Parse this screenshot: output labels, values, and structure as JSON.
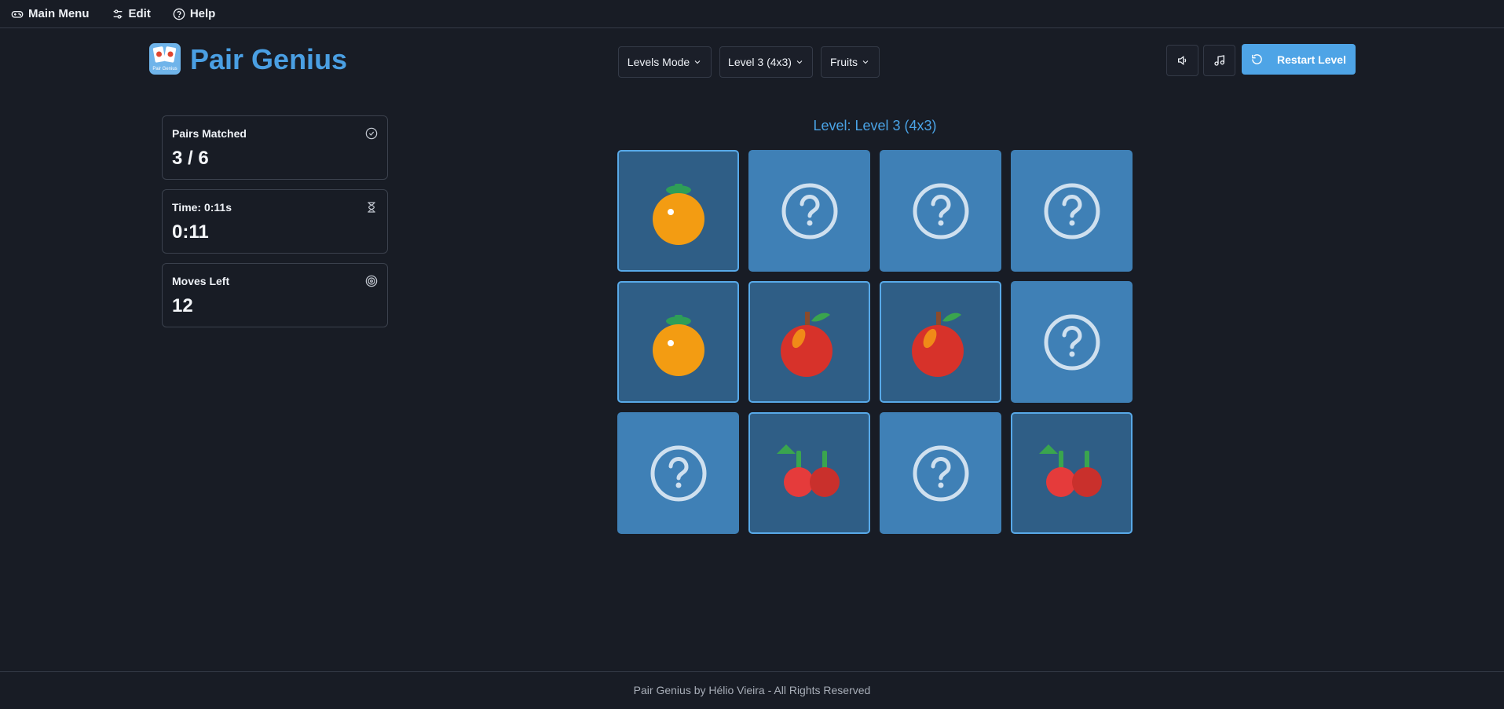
{
  "menubar": {
    "items": [
      {
        "label": "Main Menu",
        "icon": "gamepad-icon"
      },
      {
        "label": "Edit",
        "icon": "sliders-icon"
      },
      {
        "label": "Help",
        "icon": "help-circle-icon"
      }
    ]
  },
  "header": {
    "app_title": "Pair Genius",
    "logo_caption": "Pair Genius",
    "mode_select": "Levels Mode",
    "level_select": "Level 3 (4x3)",
    "theme_select": "Fruits",
    "restart_label": "Restart Level",
    "accent_color": "#4ea4e6"
  },
  "stats": {
    "pairs": {
      "label": "Pairs Matched",
      "value": "3 / 6",
      "icon": "check-circle-icon"
    },
    "time": {
      "label": "Time: 0:11s",
      "value": "0:11",
      "icon": "hourglass-icon"
    },
    "moves": {
      "label": "Moves Left",
      "value": "12",
      "icon": "target-icon"
    }
  },
  "board": {
    "heading": "Level: Level 3 (4x3)",
    "columns": 4,
    "rows": 3,
    "cards": [
      {
        "state": "revealed",
        "fruit": "orange"
      },
      {
        "state": "hidden",
        "fruit": "question-mark"
      },
      {
        "state": "hidden",
        "fruit": "question-mark"
      },
      {
        "state": "hidden",
        "fruit": "question-mark"
      },
      {
        "state": "revealed",
        "fruit": "orange"
      },
      {
        "state": "revealed",
        "fruit": "apple"
      },
      {
        "state": "revealed",
        "fruit": "apple"
      },
      {
        "state": "hidden",
        "fruit": "question-mark"
      },
      {
        "state": "hidden",
        "fruit": "question-mark"
      },
      {
        "state": "revealed",
        "fruit": "cherries"
      },
      {
        "state": "hidden",
        "fruit": "question-mark"
      },
      {
        "state": "revealed",
        "fruit": "cherries"
      }
    ]
  },
  "footer": {
    "text": "Pair Genius by Hélio Vieira - All Rights Reserved"
  }
}
